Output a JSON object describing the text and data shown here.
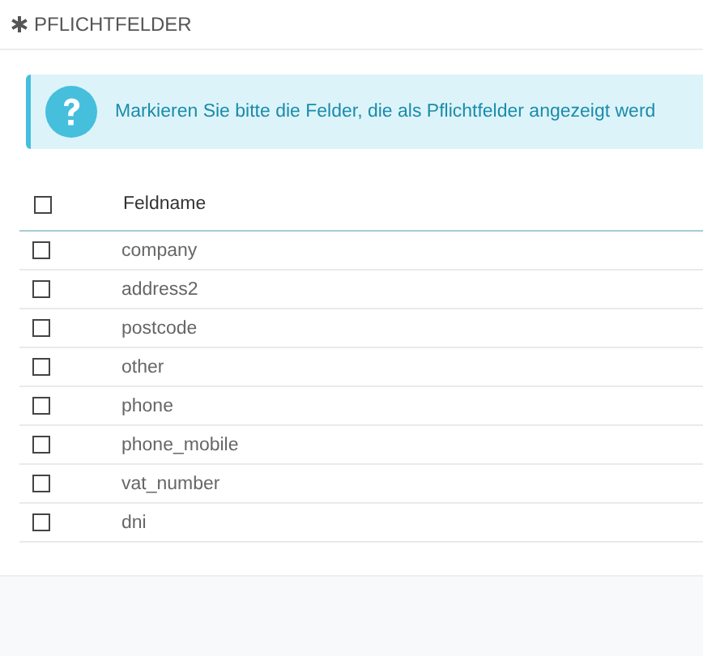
{
  "panel": {
    "title": "PFLICHTFELDER"
  },
  "alert": {
    "text": "Markieren Sie bitte die Felder, die als Pflichtfelder angezeigt werd"
  },
  "table": {
    "header": {
      "checked": false,
      "label": "Feldname"
    },
    "rows": [
      {
        "name": "company",
        "checked": false
      },
      {
        "name": "address2",
        "checked": false
      },
      {
        "name": "postcode",
        "checked": false
      },
      {
        "name": "other",
        "checked": false
      },
      {
        "name": "phone",
        "checked": false
      },
      {
        "name": "phone_mobile",
        "checked": false
      },
      {
        "name": "vat_number",
        "checked": false
      },
      {
        "name": "dni",
        "checked": false
      }
    ]
  }
}
